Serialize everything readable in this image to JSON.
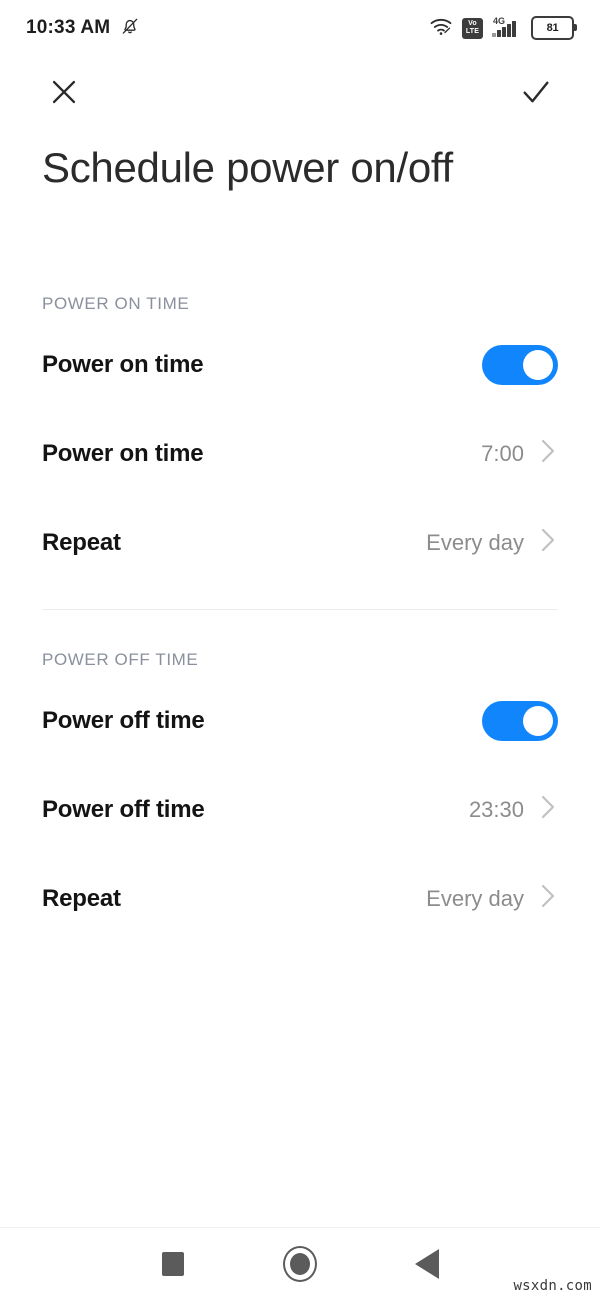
{
  "status_bar": {
    "time": "10:33 AM",
    "mute_icon": "bell-off-icon",
    "wifi_icon": "wifi-icon",
    "volte_top": "Vo",
    "volte_bottom": "LTE",
    "network_generation": "4G",
    "signal_icon": "signal-bars-icon",
    "battery_percent": "81"
  },
  "app_bar": {
    "close_icon": "close-icon",
    "confirm_icon": "check-icon"
  },
  "page": {
    "title": "Schedule power on/off"
  },
  "sections": [
    {
      "header": "POWER ON TIME",
      "rows": [
        {
          "label": "Power on time",
          "control": "toggle",
          "toggle_on": true
        },
        {
          "label": "Power on time",
          "control": "value",
          "value": "7:00",
          "chevron": "chevron-right-icon"
        },
        {
          "label": "Repeat",
          "control": "value",
          "value": "Every day",
          "chevron": "chevron-right-icon"
        }
      ]
    },
    {
      "header": "POWER OFF TIME",
      "rows": [
        {
          "label": "Power off time",
          "control": "toggle",
          "toggle_on": true
        },
        {
          "label": "Power off time",
          "control": "value",
          "value": "23:30",
          "chevron": "chevron-right-icon"
        },
        {
          "label": "Repeat",
          "control": "value",
          "value": "Every day",
          "chevron": "chevron-right-icon"
        }
      ]
    }
  ],
  "nav_bar": {
    "recents_icon": "square-recents-icon",
    "home_icon": "circle-home-icon",
    "back_icon": "triangle-back-icon"
  },
  "watermark": "wsxdn.com",
  "colors": {
    "accent": "#1186fc",
    "label": "#141414",
    "value": "#8c8c8c",
    "section_header": "#8b909e",
    "divider": "#ececec",
    "nav_icon": "#5b5b5b"
  }
}
